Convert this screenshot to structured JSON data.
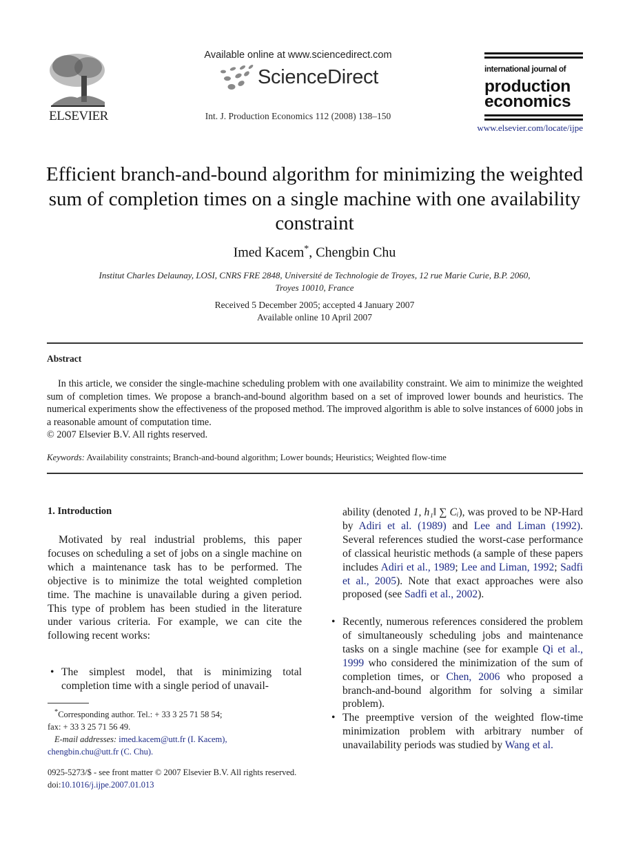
{
  "header": {
    "publisher_name": "ELSEVIER",
    "available_online": "Available online at www.sciencedirect.com",
    "sciencedirect_brand": "ScienceDirect",
    "journal_citation": "Int. J. Production Economics 112 (2008) 138–150",
    "journal_masthead": {
      "line1": "international journal of",
      "line2": "production",
      "line3": "economics"
    },
    "journal_url": "www.elsevier.com/locate/ijpe"
  },
  "article": {
    "title": "Efficient branch-and-bound algorithm for minimizing the weighted sum of completion times on a single machine with one availability constraint",
    "authors": [
      {
        "name": "Imed Kacem",
        "mark": "*"
      },
      {
        "name": "Chengbin Chu",
        "mark": ""
      }
    ],
    "author_separator": ", ",
    "affiliation_line1": "Institut Charles Delaunay, LOSI, CNRS FRE 2848, Université de Technologie de Troyes, 12 rue Marie Curie, B.P. 2060,",
    "affiliation_line2": "Troyes 10010, France",
    "received": "Received 5 December 2005; accepted 4 January 2007",
    "available": "Available online 10 April 2007"
  },
  "abstract": {
    "heading": "Abstract",
    "text": "In this article, we consider the single-machine scheduling problem with one availability constraint. We aim to minimize the weighted sum of completion times. We propose a branch-and-bound algorithm based on a set of improved lower bounds and heuristics. The numerical experiments show the effectiveness of the proposed method. The improved algorithm is able to solve instances of 6000 jobs in a reasonable amount of computation time.",
    "copyright": "© 2007 Elsevier B.V. All rights reserved."
  },
  "keywords": {
    "label": "Keywords:",
    "text": "Availability constraints; Branch-and-bound algorithm; Lower bounds; Heuristics; Weighted flow-time"
  },
  "introduction": {
    "heading": "1.  Introduction",
    "paragraph": "Motivated by real industrial problems, this paper focuses on scheduling a set of jobs on a single machine on which a maintenance task has to be performed. The objective is to minimize the total weighted completion time. The machine is unavailable during a given period. This type of problem has been studied in the literature under various criteria. For example, we can cite the following recent works:",
    "bullet1_start": "The simplest model, that is minimizing total completion time with a single period of unavail-",
    "bullet1_cont": {
      "t1": "ability (denoted ",
      "notation": "1, h₁‖ ∑ Cᵢ",
      "t2": "), was proved to be NP-Hard by ",
      "ref1": "Adiri et al. (1989)",
      "t3": " and ",
      "ref2": "Lee and Liman (1992)",
      "t4": ". Several references studied the worst-case performance of classical heuristic methods (a sample of these papers includes ",
      "ref3": "Adiri et al., 1989",
      "t5": "; ",
      "ref4": "Lee and Liman, 1992",
      "t6": "; ",
      "ref5": "Sadfi et al., 2005",
      "t7": "). Note that exact approaches were also proposed (see ",
      "ref6": "Sadfi et al., 2002",
      "t8": ")."
    },
    "bullet2": {
      "t1": "Recently, numerous references considered the problem of simultaneously scheduling jobs and maintenance tasks on a single machine (see for example ",
      "ref1": "Qi et al., 1999",
      "t2": " who considered the minimization of the sum of completion times, or ",
      "ref2": "Chen, 2006",
      "t3": " who proposed a branch-and-bound algorithm for solving a similar problem)."
    },
    "bullet3": {
      "t1": "The preemptive version of the weighted flow-time minimization problem with arbitrary number of unavailability periods was studied by ",
      "ref1": "Wang et al."
    },
    "bullet_glyph": "•"
  },
  "footnote": {
    "mark": "*",
    "corresponding": "Corresponding author. Tel.:  + 33 3 25 71 58 54;",
    "fax": "fax:  + 33 3 25 71 56 49.",
    "email_label": "E-mail addresses:",
    "email1": "imed.kacem@utt.fr",
    "email1_name": " (I. Kacem),",
    "email2": "chengbin.chu@utt.fr",
    "email2_name": " (C. Chu)."
  },
  "bottom": {
    "issn_line": "0925-5273/$ - see front matter © 2007 Elsevier B.V. All rights reserved.",
    "doi_label": "doi:",
    "doi": "10.1016/j.ijpe.2007.01.013"
  },
  "colors": {
    "link": "#1d2a86",
    "text": "#1a1a1a"
  }
}
